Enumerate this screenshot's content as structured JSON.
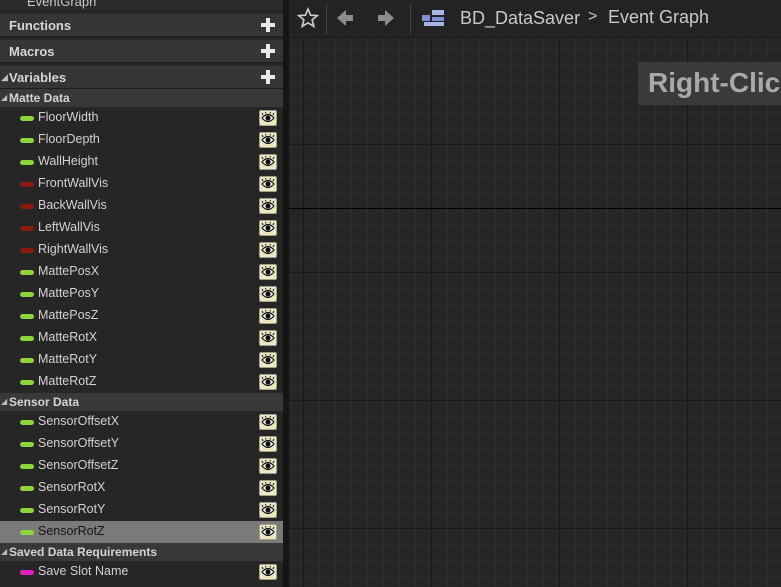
{
  "tree_top": {
    "label": "EventGraph"
  },
  "categories": {
    "functions": "Functions",
    "macros": "Macros",
    "variables": "Variables"
  },
  "groups": [
    {
      "title": "Matte Data",
      "vars": [
        {
          "name": "FloorWidth",
          "type_color": "#8ed43a"
        },
        {
          "name": "FloorDepth",
          "type_color": "#8ed43a"
        },
        {
          "name": "WallHeight",
          "type_color": "#8ed43a"
        },
        {
          "name": "FrontWallVis",
          "type_color": "#8a1a10"
        },
        {
          "name": "BackWallVis",
          "type_color": "#8a1a10"
        },
        {
          "name": "LeftWallVis",
          "type_color": "#8a1a10"
        },
        {
          "name": "RightWallVis",
          "type_color": "#8a1a10"
        },
        {
          "name": "MattePosX",
          "type_color": "#8ed43a"
        },
        {
          "name": "MattePosY",
          "type_color": "#8ed43a"
        },
        {
          "name": "MattePosZ",
          "type_color": "#8ed43a"
        },
        {
          "name": "MatteRotX",
          "type_color": "#8ed43a"
        },
        {
          "name": "MatteRotY",
          "type_color": "#8ed43a"
        },
        {
          "name": "MatteRotZ",
          "type_color": "#8ed43a"
        }
      ]
    },
    {
      "title": "Sensor Data",
      "vars": [
        {
          "name": "SensorOffsetX",
          "type_color": "#8ed43a"
        },
        {
          "name": "SensorOffsetY",
          "type_color": "#8ed43a"
        },
        {
          "name": "SensorOffsetZ",
          "type_color": "#8ed43a"
        },
        {
          "name": "SensorRotX",
          "type_color": "#8ed43a"
        },
        {
          "name": "SensorRotY",
          "type_color": "#8ed43a"
        },
        {
          "name": "SensorRotZ",
          "type_color": "#8ed43a",
          "selected": true
        }
      ]
    },
    {
      "title": "Saved Data Requirements",
      "vars": [
        {
          "name": "Save Slot Name",
          "type_color": "#e020c0"
        }
      ]
    }
  ],
  "toolbar": {
    "favorite_icon": "star-icon",
    "back_icon": "arrow-left-icon",
    "forward_icon": "arrow-right-icon",
    "blueprint_icon": "blueprint-icon"
  },
  "breadcrumb": {
    "root": "BD_DataSaver",
    "separator": ">",
    "current": "Event Graph"
  },
  "graph": {
    "hint_text": "Right-Click"
  },
  "colors": {
    "float_var": "#8ed43a",
    "bool_var": "#8a1a10",
    "string_var": "#e020c0",
    "selected_row": "#7a7a7a",
    "eye_button": "#ece8c6"
  }
}
